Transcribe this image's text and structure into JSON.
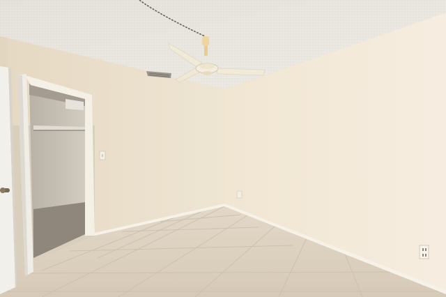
{
  "scene": {
    "subject": "empty-bedroom",
    "colors": {
      "ceiling": "#e9e6df",
      "left_wall": "#ece2cf",
      "right_wall": "#f3e9d6",
      "floor": "#ddd1c1",
      "baseboard": "#f6f1e6",
      "door": "#f2f0ea",
      "closet_interior": "#c9c3b8",
      "fan_blade": "#f0ead8",
      "fan_brass": "#efd6a0"
    },
    "icons": {
      "ceiling_fan": "ceiling-fan-icon",
      "air_vent": "air-vent-icon",
      "light_switch": "light-switch-icon",
      "wall_outlet": "wall-outlet-icon",
      "door_handle": "door-handle-icon",
      "pull_chain": "pull-chain-icon"
    }
  }
}
